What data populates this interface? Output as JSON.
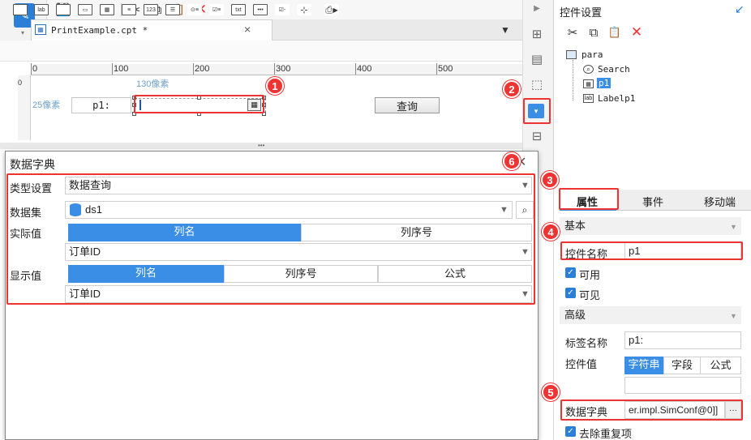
{
  "app": {
    "tab_title": "PrintExample.cpt *",
    "tab_close": "×",
    "logo_glyph": "✎",
    "caret": "▾"
  },
  "toolbar": {
    "save": "💾",
    "undo": "↶",
    "redo": "↷",
    "cut": "✂",
    "copy": "⧉",
    "paste": "📋",
    "delete": "✕",
    "delete_color": "#e33333"
  },
  "ruler": {
    "ticks": [
      "0",
      "100",
      "200",
      "300",
      "400",
      "500"
    ]
  },
  "canvas": {
    "width_dim": "130像素",
    "height_dim": "25像素",
    "label_text": "p1:",
    "search_button": "查询",
    "splitter_dots": "•••"
  },
  "badges": [
    "1",
    "2",
    "3",
    "4",
    "5",
    "6"
  ],
  "right_panel": {
    "title": "控件设置",
    "tree": {
      "root": "para",
      "items": [
        "Search",
        "p1",
        "Labelp1"
      ]
    },
    "tabs": [
      "属性",
      "事件",
      "移动端"
    ],
    "sections": {
      "basic": "基本",
      "advanced": "高级"
    },
    "control_name_label": "控件名称",
    "control_name_value": "p1",
    "enabled_label": "可用",
    "visible_label": "可见",
    "tag_name_label": "标签名称",
    "tag_name_value": "p1:",
    "control_value_label": "控件值",
    "value_types": [
      "字符串",
      "字段",
      "公式"
    ],
    "data_dict_label": "数据字典",
    "data_dict_value": "er.impl.SimConf@0]]",
    "data_dict_btn": "···",
    "dedupe_label": "去除重复项"
  },
  "dialog": {
    "title": "数据字典",
    "type_label": "类型设置",
    "type_value": "数据查询",
    "dataset_label": "数据集",
    "dataset_value": "ds1",
    "actual_label": "实际值",
    "actual_tabs": [
      "列名",
      "列序号"
    ],
    "actual_value": "订单ID",
    "display_label": "显示值",
    "display_tabs": [
      "列名",
      "列序号",
      "公式"
    ],
    "display_value": "订单ID"
  },
  "colors": {
    "accent": "#3b8ee6",
    "highlight": "#e33333"
  }
}
